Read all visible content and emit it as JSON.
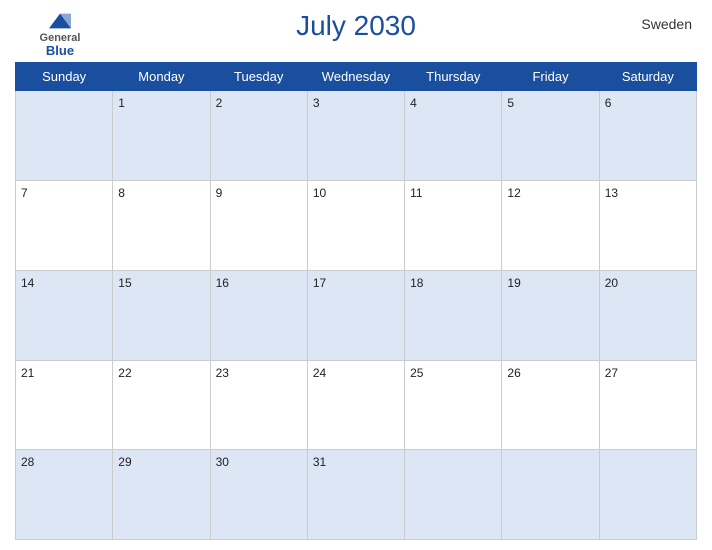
{
  "header": {
    "logo": {
      "general": "General",
      "blue": "Blue"
    },
    "title": "July 2030",
    "country": "Sweden"
  },
  "weekdays": [
    "Sunday",
    "Monday",
    "Tuesday",
    "Wednesday",
    "Thursday",
    "Friday",
    "Saturday"
  ],
  "weeks": [
    [
      "",
      "1",
      "2",
      "3",
      "4",
      "5",
      "6"
    ],
    [
      "7",
      "8",
      "9",
      "10",
      "11",
      "12",
      "13"
    ],
    [
      "14",
      "15",
      "16",
      "17",
      "18",
      "19",
      "20"
    ],
    [
      "21",
      "22",
      "23",
      "24",
      "25",
      "26",
      "27"
    ],
    [
      "28",
      "29",
      "30",
      "31",
      "",
      "",
      ""
    ]
  ],
  "colors": {
    "header_bg": "#1a4fa0",
    "row_odd": "#dce6f5",
    "row_even": "#ffffff"
  }
}
